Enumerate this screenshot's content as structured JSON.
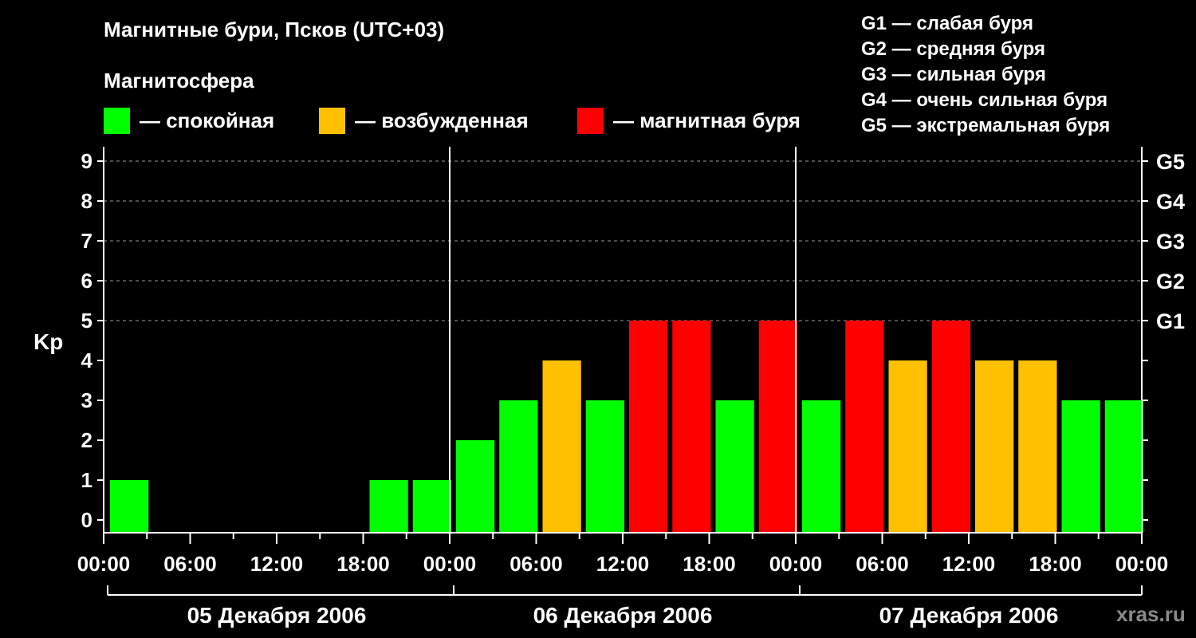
{
  "header": {
    "title": "Магнитные бури, Псков (UTC+03)",
    "subtitle": "Магнитосфера"
  },
  "legend": [
    {
      "color": "#00ff00",
      "label": "— спокойная"
    },
    {
      "color": "#ffc000",
      "label": "— возбужденная"
    },
    {
      "color": "#ff0000",
      "label": "— магнитная буря"
    }
  ],
  "g_scale": [
    "G1 — слабая буря",
    "G2 — средняя буря",
    "G3 — сильная буря",
    "G4 — очень сильная буря",
    "G5 — экстремальная буря"
  ],
  "watermark": "xras.ru",
  "chart_data": {
    "type": "bar",
    "ylabel": "Kp",
    "ylim": [
      0,
      9
    ],
    "yticks": [
      "0",
      "1",
      "2",
      "3",
      "4",
      "5",
      "6",
      "7",
      "8",
      "9"
    ],
    "right_axis_labels": [
      {
        "kp": 5,
        "label": "G1"
      },
      {
        "kp": 6,
        "label": "G2"
      },
      {
        "kp": 7,
        "label": "G3"
      },
      {
        "kp": 8,
        "label": "G4"
      },
      {
        "kp": 9,
        "label": "G5"
      }
    ],
    "x_tick_labels": [
      "00:00",
      "06:00",
      "12:00",
      "18:00",
      "00:00",
      "06:00",
      "12:00",
      "18:00",
      "00:00",
      "06:00",
      "12:00",
      "18:00",
      "00:00"
    ],
    "days": [
      "05 Декабря 2006",
      "06 Декабря 2006",
      "07 Декабря 2006"
    ],
    "interval_hours": 3,
    "values": [
      1,
      0,
      0,
      0,
      0,
      0,
      1,
      1,
      2,
      3,
      4,
      3,
      5,
      5,
      3,
      5,
      3,
      5,
      4,
      5,
      4,
      4,
      3,
      3
    ],
    "colors": {
      "quiet": "#00ff00",
      "active": "#ffc000",
      "storm": "#ff0000"
    },
    "grid": "dashed horizontal at Kp 5-9"
  }
}
